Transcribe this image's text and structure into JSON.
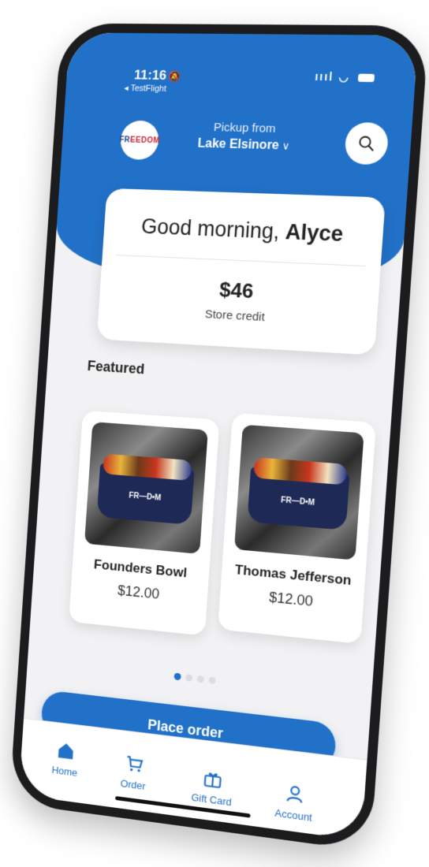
{
  "status_bar": {
    "time": "11:16",
    "back_app": "◂ TestFlight",
    "signal": "ıııl",
    "wifi": "◡"
  },
  "header": {
    "logo_text_a": "FR",
    "logo_text_b": "EEDOM",
    "pickup_label": "Pickup from",
    "pickup_location": "Lake Elsinore",
    "chevron": "∨"
  },
  "greeting_card": {
    "greeting_prefix": "Good morning,",
    "user_name": "Alyce",
    "credit_amount": "$46",
    "credit_label": "Store credit"
  },
  "featured": {
    "heading": "Featured",
    "items": [
      {
        "name": "Founders Bowl",
        "price": "$12.00",
        "bowl_label": "FR—D•M"
      },
      {
        "name": "Thomas Jefferson",
        "price": "$12.00",
        "bowl_label": "FR—D•M"
      }
    ]
  },
  "pagination": {
    "total": 4,
    "active": 0
  },
  "actions": {
    "place_order": "Place order"
  },
  "tabs": [
    {
      "label": "Home"
    },
    {
      "label": "Order"
    },
    {
      "label": "Gift Card"
    },
    {
      "label": "Account"
    }
  ],
  "colors": {
    "primary": "#2271c8",
    "background": "#f2f2f4"
  }
}
